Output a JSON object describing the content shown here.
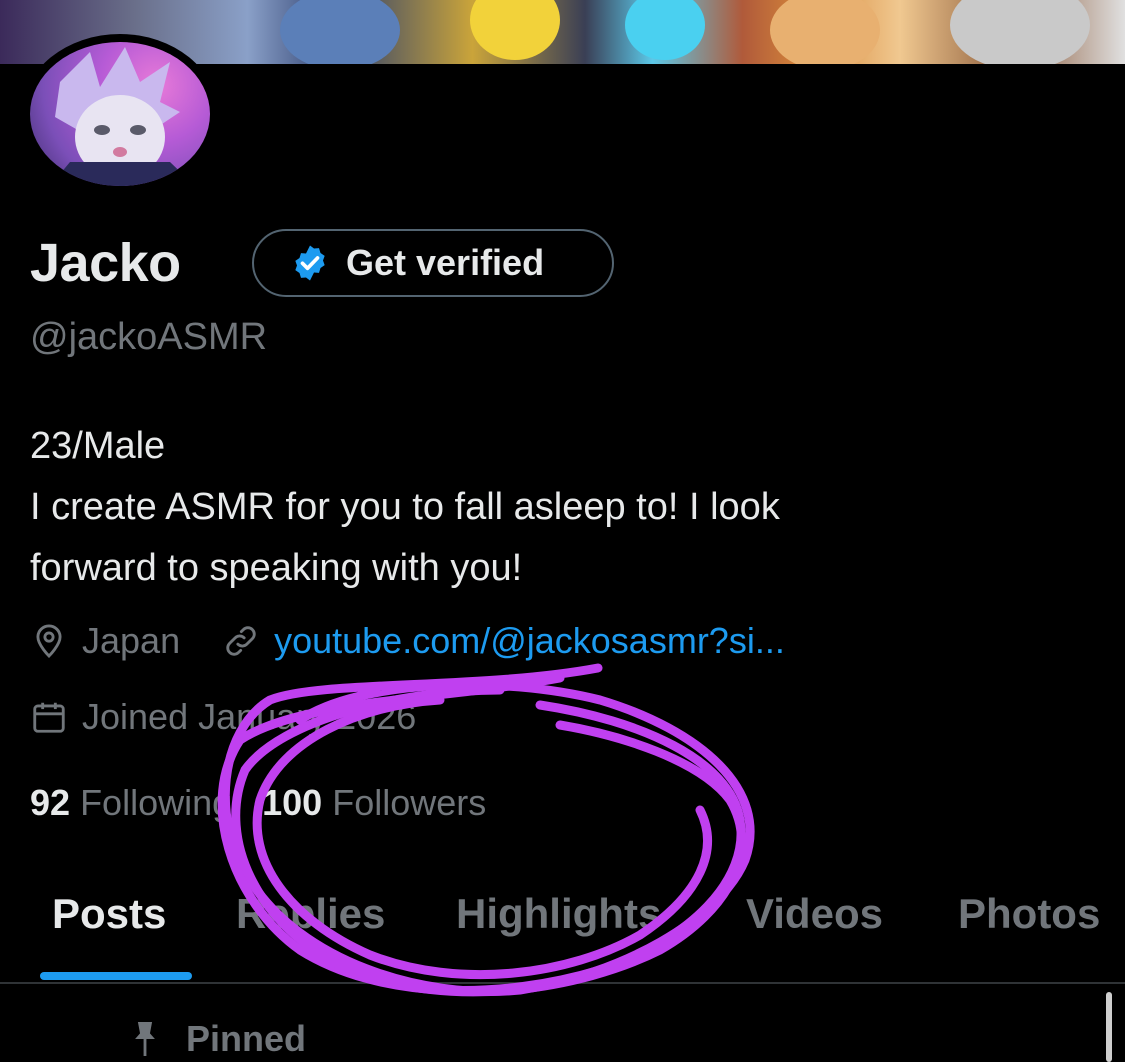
{
  "profile": {
    "name": "Jacko",
    "handle": "@jackoASMR",
    "verify_button": "Get verified",
    "bio_line1": "23/Male",
    "bio_line2": "I create ASMR for you to fall asleep to! I look",
    "bio_line3": "forward to speaking with you!",
    "location": "Japan",
    "link": "youtube.com/@jackosasmr?si...",
    "joined": "Joined January 2026",
    "following_count": "92",
    "following_label": "Following",
    "followers_count": "100",
    "followers_label": "Followers"
  },
  "tabs": [
    {
      "label": "Posts"
    },
    {
      "label": "Replies"
    },
    {
      "label": "Highlights"
    },
    {
      "label": "Videos"
    },
    {
      "label": "Photos"
    }
  ],
  "pinned_label": "Pinned",
  "colors": {
    "background": "#000000",
    "accent": "#1d9bf0",
    "muted_text": "#71767b",
    "primary_text": "#e7e9ea",
    "annotation": "#c040f0"
  },
  "icons": {
    "verify": "verified-badge-icon",
    "location": "location-pin-icon",
    "link": "link-icon",
    "calendar": "calendar-icon",
    "pin": "pushpin-icon"
  }
}
